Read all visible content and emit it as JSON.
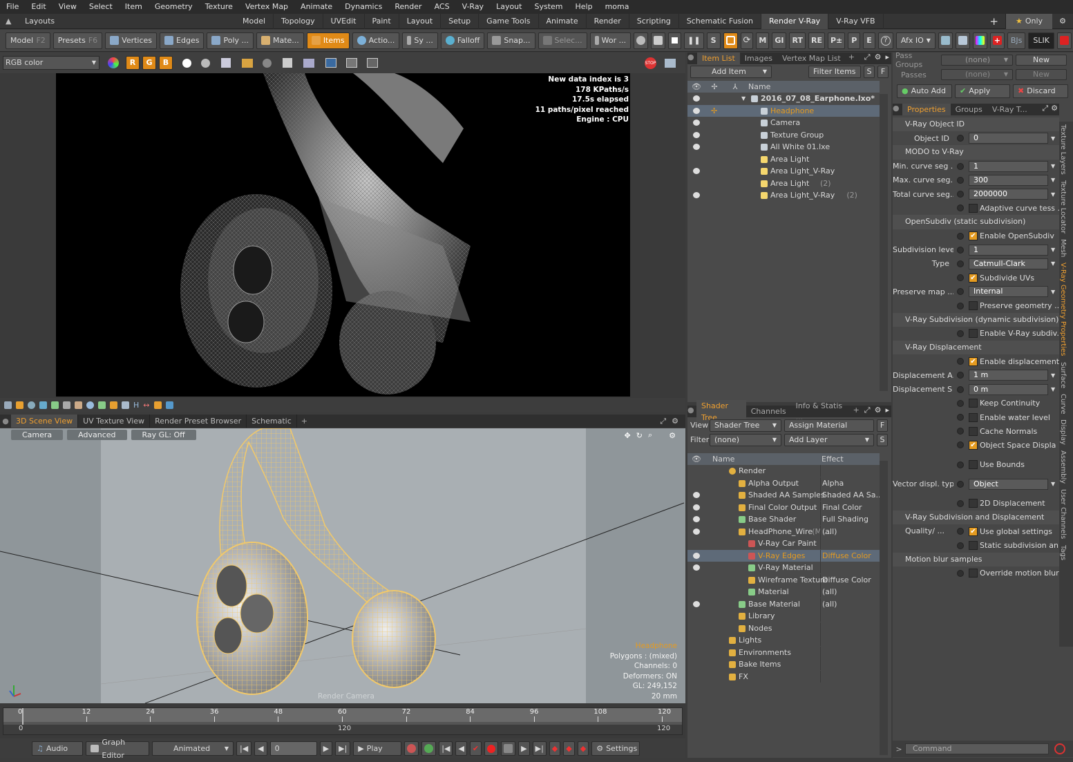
{
  "menu": [
    "File",
    "Edit",
    "View",
    "Select",
    "Item",
    "Geometry",
    "Texture",
    "Vertex Map",
    "Animate",
    "Dynamics",
    "Render",
    "ACS",
    "V-Ray",
    "Layout",
    "System",
    "Help",
    "moma"
  ],
  "layouts": {
    "label": "Layouts",
    "tabs": [
      "Model",
      "Topology",
      "UVEdit",
      "Paint",
      "Layout",
      "Setup",
      "Game Tools",
      "Animate",
      "Render",
      "Scripting",
      "Schematic Fusion",
      "Render V-Ray",
      "V-Ray VFB"
    ],
    "active": "Render V-Ray",
    "only": "Only"
  },
  "toolbar": {
    "model": "Model",
    "model_key": "F2",
    "presets": "Presets",
    "presets_key": "F6",
    "vertices": "Vertices",
    "edges": "Edges",
    "poly": "Poly ...",
    "mate": "Mate...",
    "items": "Items",
    "action": "Actio...",
    "sy": "Sy ...",
    "falloff": "Falloff",
    "snap": "Snap...",
    "select": "Selec...",
    "work": "Wor ...",
    "s": "S",
    "m": "M",
    "gi": "GI",
    "rt": "RT",
    "re": "RE",
    "pt": "P±",
    "p": "P",
    "e": "E",
    "afxio": "Afx IO",
    "bjs": "BJs",
    "slik": "SLIK"
  },
  "render_view": {
    "channel": "RGB color",
    "stats": [
      "New data index is 3",
      "178 KPaths/s",
      "17.5s elapsed",
      "11 paths/pixel reached",
      "Engine : CPU"
    ]
  },
  "viewport": {
    "tabs": [
      "3D Scene View",
      "UV Texture View",
      "Render Preset Browser",
      "Schematic"
    ],
    "hud": [
      "Camera",
      "Advanced",
      "Ray GL: Off"
    ],
    "info": [
      "Headphone",
      "Polygons : (mixed)",
      "Channels: 0",
      "Deformers: ON",
      "GL: 249,152",
      "20 mm"
    ],
    "camera_label": "Render Camera"
  },
  "timeline": {
    "ticks": [
      "0",
      "12",
      "24",
      "36",
      "48",
      "60",
      "72",
      "84",
      "96",
      "108",
      "120"
    ],
    "start": "0",
    "end": "120"
  },
  "transport": {
    "audio": "Audio",
    "graph": "Graph Editor",
    "mode": "Animated",
    "frame": "0",
    "play": "Play",
    "settings": "Settings"
  },
  "itemlist": {
    "tabs": [
      "Item List",
      "Images",
      "Vertex Map List"
    ],
    "add_item": "Add Item",
    "filter_items": "Filter Items",
    "col_name": "Name",
    "rows": [
      {
        "name": "2016_07_08_Earphone.lxo*",
        "indent": 0,
        "bold": true,
        "eye": true
      },
      {
        "name": "Headphone",
        "indent": 1,
        "sel": true,
        "eye": true,
        "hl": true
      },
      {
        "name": "Camera",
        "indent": 1,
        "eye": true
      },
      {
        "name": "Texture Group",
        "indent": 1,
        "eye": true
      },
      {
        "name": "All White 01.lxe",
        "indent": 1,
        "eye": true
      },
      {
        "name": "Area Light",
        "indent": 1,
        "eye": false
      },
      {
        "name": "Area Light_V-Ray",
        "indent": 1,
        "eye": true
      },
      {
        "name": "Area Light",
        "suffix": "(2)",
        "indent": 1,
        "eye": false
      },
      {
        "name": "Area Light_V-Ray",
        "suffix": "(2)",
        "indent": 1,
        "eye": true
      }
    ]
  },
  "shader": {
    "tabs": [
      "Shader Tree",
      "Channels",
      "Info & Statis ..."
    ],
    "view_label": "View",
    "view": "Shader Tree",
    "assign": "Assign Material",
    "filter_label": "Filter",
    "filter": "(none)",
    "add_layer": "Add Layer",
    "col_name": "Name",
    "col_effect": "Effect",
    "rows": [
      {
        "name": "Render",
        "effect": "",
        "indent": 0,
        "eye": false
      },
      {
        "name": "Alpha Output",
        "effect": "Alpha",
        "indent": 1,
        "eye": false
      },
      {
        "name": "Shaded AA Samples ...",
        "effect": "Shaded AA Sa...",
        "indent": 1,
        "eye": true
      },
      {
        "name": "Final Color Output",
        "effect": "Final Color",
        "indent": 1,
        "eye": true
      },
      {
        "name": "Base Shader",
        "effect": "Full Shading",
        "indent": 1,
        "eye": true
      },
      {
        "name": "HeadPhone_Wire",
        "suffix": "(M ...",
        "effect": "(all)",
        "indent": 1,
        "eye": true
      },
      {
        "name": "V-Ray Car Paint",
        "effect": "",
        "indent": 2,
        "eye": false
      },
      {
        "name": "V-Ray Edges",
        "effect": "Diffuse Color",
        "indent": 2,
        "eye": true,
        "sel": true
      },
      {
        "name": "V-Ray Material",
        "effect": "",
        "indent": 2,
        "eye": true
      },
      {
        "name": "Wireframe Texture",
        "effect": "Diffuse Color",
        "indent": 2,
        "eye": false
      },
      {
        "name": "Material",
        "effect": "(all)",
        "indent": 2,
        "eye": false
      },
      {
        "name": "Base Material",
        "effect": "(all)",
        "indent": 1,
        "eye": true
      },
      {
        "name": "Library",
        "effect": "",
        "indent": 1,
        "eye": false
      },
      {
        "name": "Nodes",
        "effect": "",
        "indent": 1,
        "eye": false
      },
      {
        "name": "Lights",
        "effect": "",
        "indent": 0,
        "eye": false
      },
      {
        "name": "Environments",
        "effect": "",
        "indent": 0,
        "eye": false
      },
      {
        "name": "Bake Items",
        "effect": "",
        "indent": 0,
        "eye": false
      },
      {
        "name": "FX",
        "effect": "",
        "indent": 0,
        "eye": false
      }
    ]
  },
  "props": {
    "pass_groups": "Pass Groups",
    "pass_groups_val": "(none)",
    "passes": "Passes",
    "passes_val": "(none)",
    "new": "New",
    "auto_add": "Auto Add",
    "apply": "Apply",
    "discard": "Discard",
    "tabs": [
      "Properties",
      "Groups",
      "V-Ray T..."
    ],
    "rows": [
      {
        "type": "sect",
        "label": "V-Ray Object ID"
      },
      {
        "type": "val",
        "label": "Object ID",
        "value": "0"
      },
      {
        "type": "sect",
        "label": "MODO to V-Ray"
      },
      {
        "type": "val",
        "label": "Min. curve seg ...",
        "value": "1"
      },
      {
        "type": "val",
        "label": "Max. curve seg...",
        "value": "300"
      },
      {
        "type": "val",
        "label": "Total curve seg...",
        "value": "2000000"
      },
      {
        "type": "chk",
        "label": "Adaptive curve tess ...",
        "on": false
      },
      {
        "type": "sect",
        "label": "OpenSubdiv (static subdivision)"
      },
      {
        "type": "chk",
        "label": "Enable OpenSubdiv",
        "on": true
      },
      {
        "type": "val",
        "label": "Subdivision level",
        "value": "1"
      },
      {
        "type": "val",
        "label": "Type",
        "value": "Catmull-Clark"
      },
      {
        "type": "chk",
        "label": "Subdivide UVs",
        "on": true
      },
      {
        "type": "val",
        "label": "Preserve map ...",
        "value": "Internal"
      },
      {
        "type": "chk",
        "label": "Preserve geometry ...",
        "on": false
      },
      {
        "type": "sect",
        "label": "V-Ray Subdivision (dynamic subdivision)"
      },
      {
        "type": "chk",
        "label": "Enable V-Ray subdiv...",
        "on": false
      },
      {
        "type": "sect",
        "label": "V-Ray Displacement"
      },
      {
        "type": "chk",
        "label": "Enable displacement",
        "on": true
      },
      {
        "type": "val",
        "label": "Displacement A...",
        "value": "1 m"
      },
      {
        "type": "val",
        "label": "Displacement S ...",
        "value": "0 m"
      },
      {
        "type": "chk",
        "label": "Keep Continuity",
        "on": false
      },
      {
        "type": "chk",
        "label": "Enable water level",
        "on": false
      },
      {
        "type": "chk",
        "label": "Cache Normals",
        "on": false
      },
      {
        "type": "chk",
        "label": "Object Space Displa ...",
        "on": true
      },
      {
        "type": "gap"
      },
      {
        "type": "chk",
        "label": "Use Bounds",
        "on": false
      },
      {
        "type": "gap"
      },
      {
        "type": "val",
        "label": "Vector displ. type",
        "value": "Object"
      },
      {
        "type": "gap"
      },
      {
        "type": "chk",
        "label": "2D Displacement",
        "on": false
      },
      {
        "type": "sect",
        "label": "V-Ray Subdivision and Displacement Quality/ ..."
      },
      {
        "type": "chk",
        "label": "Use global settings",
        "on": true
      },
      {
        "type": "chk",
        "label": "Static subdivision an ...",
        "on": false
      },
      {
        "type": "sect",
        "label": "Motion blur samples"
      },
      {
        "type": "chk",
        "label": "Override motion blur ...",
        "on": false
      }
    ],
    "side_tabs": [
      "Texture Layers",
      "Texture Locator",
      "Mesh",
      "V-Ray Geometry Properties",
      "Surface",
      "Curve",
      "Display",
      "Assembly",
      "User Channels",
      "Tags"
    ],
    "side_active": "V-Ray Geometry Properties",
    "command": "Command"
  },
  "colors": {
    "accent": "#e59b20",
    "wire": "#f2c96a"
  }
}
